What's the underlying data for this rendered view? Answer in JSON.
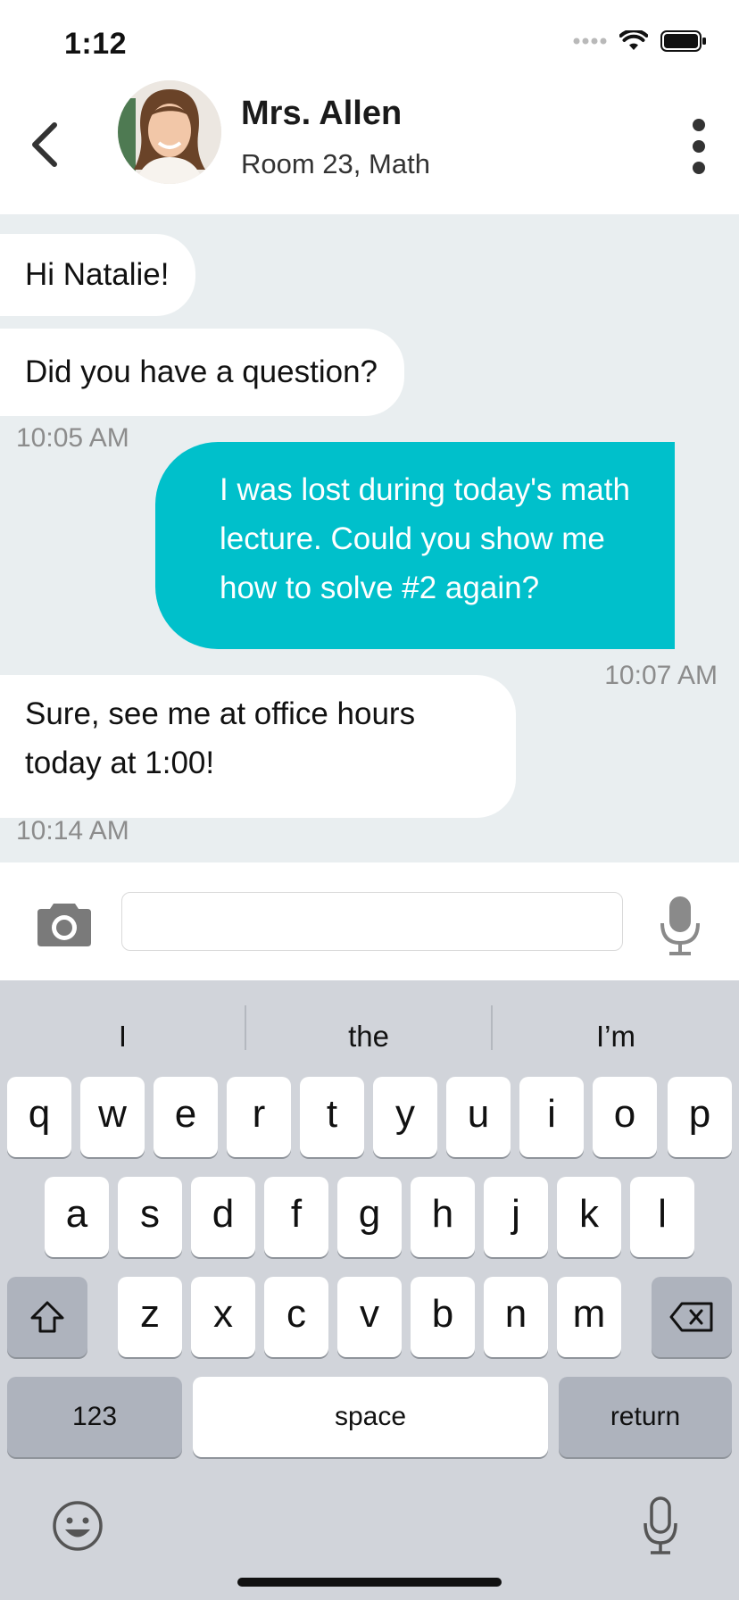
{
  "status_bar": {
    "time": "1:12"
  },
  "header": {
    "name": "Mrs. Allen",
    "subtitle": "Room 23, Math"
  },
  "messages": [
    {
      "text": "Hi Natalie!"
    },
    {
      "text": "Did you have a question?"
    },
    {
      "time": "10:05 AM"
    },
    {
      "lines": [
        "I was lost during today's math",
        "lecture. Could you show me",
        "how to solve #2 again?"
      ]
    },
    {
      "time": "10:07 AM"
    },
    {
      "lines": [
        "Sure, see me at office hours",
        "today at 1:00!"
      ]
    },
    {
      "time": "10:14 AM"
    }
  ],
  "composer": {
    "value": "",
    "placeholder": ""
  },
  "keyboard": {
    "suggestions": [
      "I",
      "the",
      "I’m"
    ],
    "row1": [
      "q",
      "w",
      "e",
      "r",
      "t",
      "y",
      "u",
      "i",
      "o",
      "p"
    ],
    "row2": [
      "a",
      "s",
      "d",
      "f",
      "g",
      "h",
      "j",
      "k",
      "l"
    ],
    "row3": [
      "z",
      "x",
      "c",
      "v",
      "b",
      "n",
      "m"
    ],
    "numbers_label": "123",
    "space_label": "space",
    "return_label": "return"
  },
  "colors": {
    "accent_teal": "#00c0cb",
    "chat_background": "#e9eef0",
    "keyboard_background": "#d1d4da"
  },
  "icons": [
    "back-chevron-icon",
    "more-vertical-icon",
    "camera-icon",
    "microphone-icon",
    "shift-icon",
    "backspace-icon",
    "emoji-icon",
    "dictation-mic-icon",
    "signal-icon",
    "wifi-icon",
    "battery-icon"
  ]
}
